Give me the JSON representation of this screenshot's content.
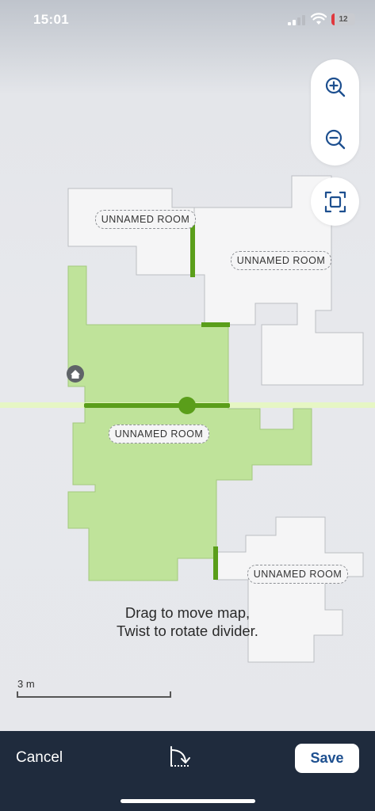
{
  "status_bar": {
    "time": "15:01",
    "battery": "12",
    "battery_level": 0.12
  },
  "map": {
    "rooms": [
      {
        "id": "room-1",
        "label": "UNNAMED ROOM",
        "selected": false
      },
      {
        "id": "room-2",
        "label": "UNNAMED ROOM",
        "selected": false
      },
      {
        "id": "room-3",
        "label": "UNNAMED ROOM",
        "selected": true
      },
      {
        "id": "room-4",
        "label": "UNNAMED ROOM",
        "selected": false
      }
    ],
    "hint_line1": "Drag to move map,",
    "hint_line2": "Twist to rotate divider.",
    "scale_label": "3 m",
    "colors": {
      "selected_room": "#bfe39a",
      "room": "#f5f5f6",
      "divider": "#5a9e1a",
      "divider_line": "#e6f7c0"
    }
  },
  "controls": {
    "zoom_in_icon": "zoom-in-icon",
    "zoom_out_icon": "zoom-out-icon",
    "fit_icon": "fit-to-screen-icon"
  },
  "bottom_bar": {
    "cancel_label": "Cancel",
    "rotate_icon": "rotate-divider-icon",
    "save_label": "Save",
    "save_color": "#1d4f8f"
  }
}
